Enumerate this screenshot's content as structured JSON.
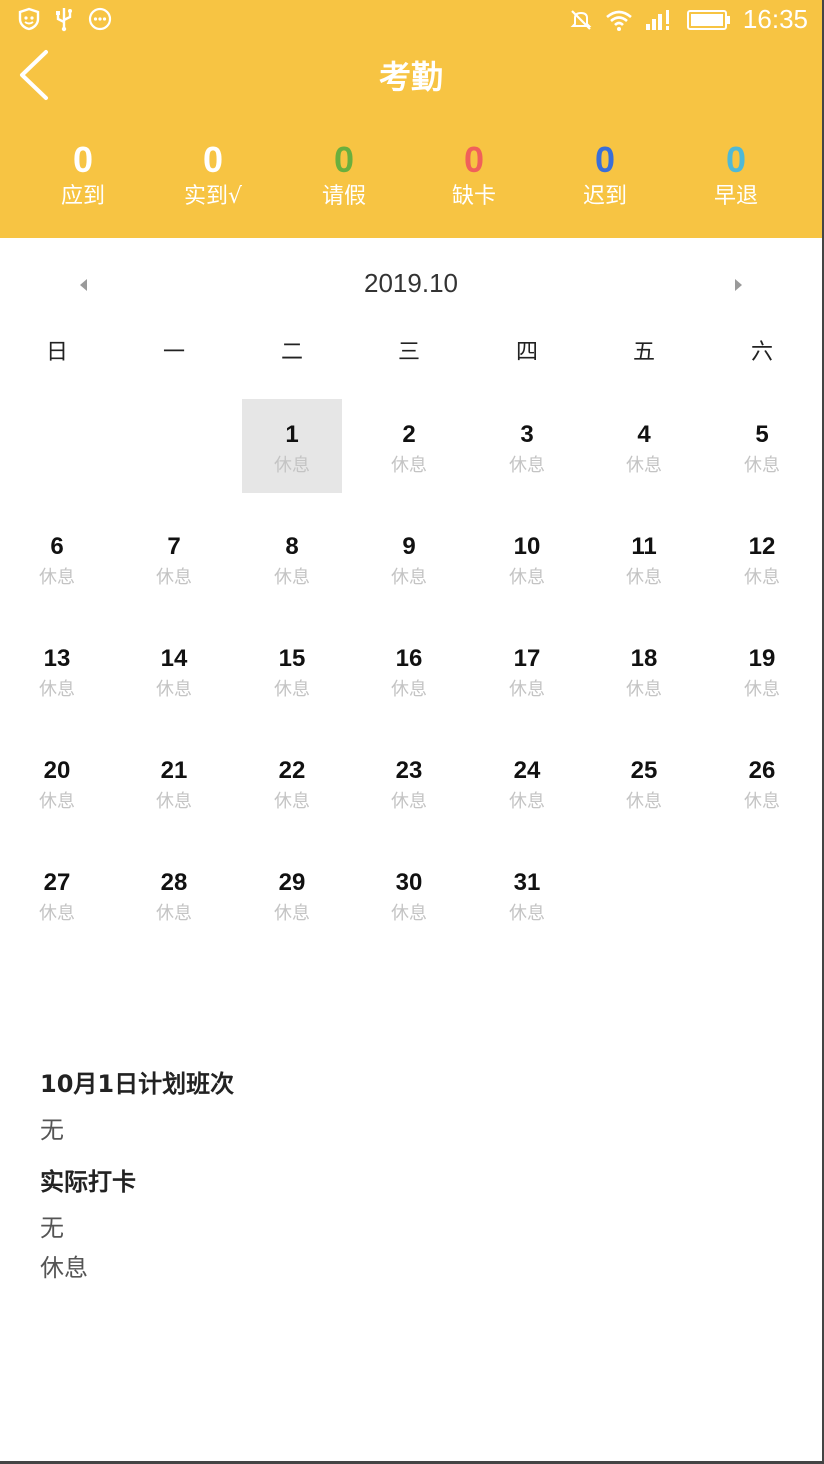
{
  "status_bar": {
    "left_icons": [
      "shield-icon",
      "usb-icon",
      "more-circle-icon"
    ],
    "right_icons": [
      "mute-icon",
      "wifi-icon",
      "signal-icon",
      "battery-icon"
    ],
    "time": "16:35"
  },
  "header": {
    "title": "考勤",
    "back_icon": "chevron-left-icon"
  },
  "stats": [
    {
      "value": "0",
      "label": "应到",
      "color": "#FFFFFF"
    },
    {
      "value": "0",
      "label": "实到√",
      "color": "#FFFFFF"
    },
    {
      "value": "0",
      "label": "请假",
      "color": "#6AAF3D"
    },
    {
      "value": "0",
      "label": "缺卡",
      "color": "#F0605A"
    },
    {
      "value": "0",
      "label": "迟到",
      "color": "#3A6FD8"
    },
    {
      "value": "0",
      "label": "早退",
      "color": "#4FB9D6"
    }
  ],
  "calendar": {
    "month": "2019.10",
    "prev_icon": "triangle-left-icon",
    "next_icon": "triangle-right-icon",
    "weekdays": [
      "日",
      "一",
      "二",
      "三",
      "四",
      "五",
      "六"
    ],
    "first_weekday_index": 2,
    "selected_day": 1,
    "days": [
      {
        "day": "1",
        "status": "休息"
      },
      {
        "day": "2",
        "status": "休息"
      },
      {
        "day": "3",
        "status": "休息"
      },
      {
        "day": "4",
        "status": "休息"
      },
      {
        "day": "5",
        "status": "休息"
      },
      {
        "day": "6",
        "status": "休息"
      },
      {
        "day": "7",
        "status": "休息"
      },
      {
        "day": "8",
        "status": "休息"
      },
      {
        "day": "9",
        "status": "休息"
      },
      {
        "day": "10",
        "status": "休息"
      },
      {
        "day": "11",
        "status": "休息"
      },
      {
        "day": "12",
        "status": "休息"
      },
      {
        "day": "13",
        "status": "休息"
      },
      {
        "day": "14",
        "status": "休息"
      },
      {
        "day": "15",
        "status": "休息"
      },
      {
        "day": "16",
        "status": "休息"
      },
      {
        "day": "17",
        "status": "休息"
      },
      {
        "day": "18",
        "status": "休息"
      },
      {
        "day": "19",
        "status": "休息"
      },
      {
        "day": "20",
        "status": "休息"
      },
      {
        "day": "21",
        "status": "休息"
      },
      {
        "day": "22",
        "status": "休息"
      },
      {
        "day": "23",
        "status": "休息"
      },
      {
        "day": "24",
        "status": "休息"
      },
      {
        "day": "25",
        "status": "休息"
      },
      {
        "day": "26",
        "status": "休息"
      },
      {
        "day": "27",
        "status": "休息"
      },
      {
        "day": "28",
        "status": "休息"
      },
      {
        "day": "29",
        "status": "休息"
      },
      {
        "day": "30",
        "status": "休息"
      },
      {
        "day": "31",
        "status": "休息"
      }
    ]
  },
  "detail": {
    "plan_title": "10月1日计划班次",
    "plan_value": "无",
    "actual_title": "实际打卡",
    "actual_value": "无",
    "actual_status": "休息"
  },
  "colors": {
    "header_bg": "#F7C443",
    "selected_bg": "#E6E6E6"
  }
}
